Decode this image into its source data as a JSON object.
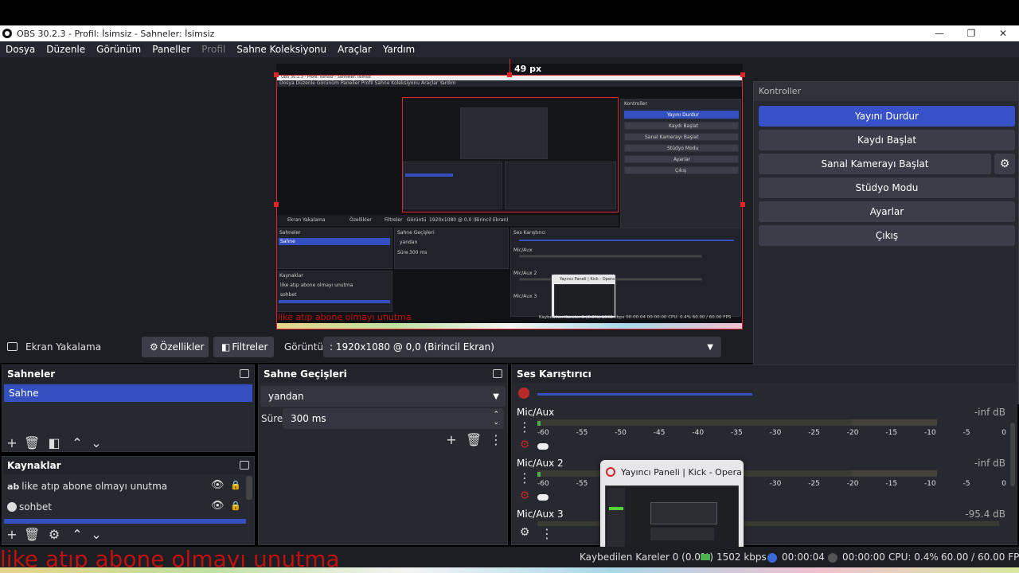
{
  "window": {
    "title": "OBS 30.2.3 - Profil: İsimsiz - Sahneler: İsimsiz",
    "minimize": "—",
    "maximize": "❐",
    "close": "✕"
  },
  "menu": [
    "Dosya",
    "Düzenle",
    "Görünüm",
    "Paneller",
    "Profil",
    "Sahne Koleksiyonu",
    "Araçlar",
    "Yardım"
  ],
  "preview": {
    "guide_label": "49 px",
    "nested_title": "OBS 30.2.3 - Profil: İsimsiz - Sahneler: İsimsiz",
    "nested_menu": "Dosya  Düzenle  Görünüm  Paneller  Profil  Sahne Koleksiyonu  Araçlar  Yardım",
    "nested_source": "Ekran Yakalama",
    "nested_properties": "Özellikler",
    "nested_filters": "Filtreler",
    "nested_display": "Görüntü",
    "nested_display_value": "1920x1080 @ 0,0 (Birincil Ekran)",
    "nested_scenes": "Sahneler",
    "nested_scene_item": "Sahne",
    "nested_transitions": "Sahne Geçişleri",
    "nested_transition_value": "yandan",
    "nested_duration": "Süre",
    "nested_duration_value": "300 ms",
    "nested_mixer": "Ses Karıştırıcı",
    "nested_mic1": "Mic/Aux",
    "nested_mic2": "Mic/Aux 2",
    "nested_mic3": "Mic/Aux 3",
    "nested_sources": "Kaynaklar",
    "nested_src1": "like atıp abone olmayı unutma",
    "nested_src2": "sohbet",
    "nested_popup": "Yayıncı Paneli | Kick - Opera",
    "nested_controls": "Kontroller",
    "nested_ctrl": [
      "Yayını Durdur",
      "Kaydı Başlat",
      "Sanal Kamerayı Başlat",
      "Stüdyo Modu",
      "Ayarlar",
      "Çıkış"
    ],
    "nested_status": "Kaybedilen Kareler 0 (0.0%)   1502 kbps   00:00:04   00:00:00   CPU: 0.4%   60.00 / 60.00 FPS",
    "nested_red_text": "like atıp abone olmayı unutma"
  },
  "controls": {
    "title": "Kontroller",
    "stop_stream": "Yayını Durdur",
    "start_record": "Kaydı Başlat",
    "start_virtualcam": "Sanal Kamerayı Başlat",
    "studio_mode": "Stüdyo Modu",
    "settings": "Ayarlar",
    "exit": "Çıkış"
  },
  "source_toolbar": {
    "source_name": "Ekran Yakalama",
    "properties": "Özellikler",
    "filters": "Filtreler",
    "display_label": "Görüntü",
    "display_value": ": 1920x1080 @ 0,0 (Birincil Ekran)"
  },
  "scenes": {
    "title": "Sahneler",
    "items": [
      "Sahne"
    ]
  },
  "transitions": {
    "title": "Sahne Geçişleri",
    "type": "yandan",
    "duration_label": "Süre",
    "duration_value": "300 ms"
  },
  "mixer": {
    "title": "Ses Karıştırıcı",
    "scale": [
      "-60",
      "-55",
      "-50",
      "-45",
      "-40",
      "-35",
      "-30",
      "-25",
      "-20",
      "-15",
      "-10",
      "-5",
      "0"
    ],
    "channels": [
      {
        "name": "Mic/Aux",
        "db": "-inf dB"
      },
      {
        "name": "Mic/Aux 2",
        "db": "-inf dB"
      },
      {
        "name": "Mic/Aux 3",
        "db": "-95.4 dB"
      }
    ]
  },
  "sources": {
    "title": "Kaynaklar",
    "items": [
      {
        "label": "like atıp abone olmayı unutma",
        "icon": "text-icon"
      },
      {
        "label": "sohbet",
        "icon": "browser-icon"
      }
    ]
  },
  "status": {
    "dropped": "Kaybedilen Kareler 0 (0.0%)",
    "bitrate": "1502 kbps",
    "stream_time": "00:00:04",
    "record_time": "00:00:00",
    "cpu": "CPU: 0.4%",
    "fps": "60.00 / 60.00 FPS"
  },
  "taskbar_popup": {
    "title": "Yayıncı Paneli | Kick - Opera"
  },
  "overlay_text": "like atıp abone olmayı unutma",
  "colors": {
    "accent": "#3450c0",
    "panel": "#272930",
    "background": "#1d1e23",
    "red": "#e0252b"
  }
}
